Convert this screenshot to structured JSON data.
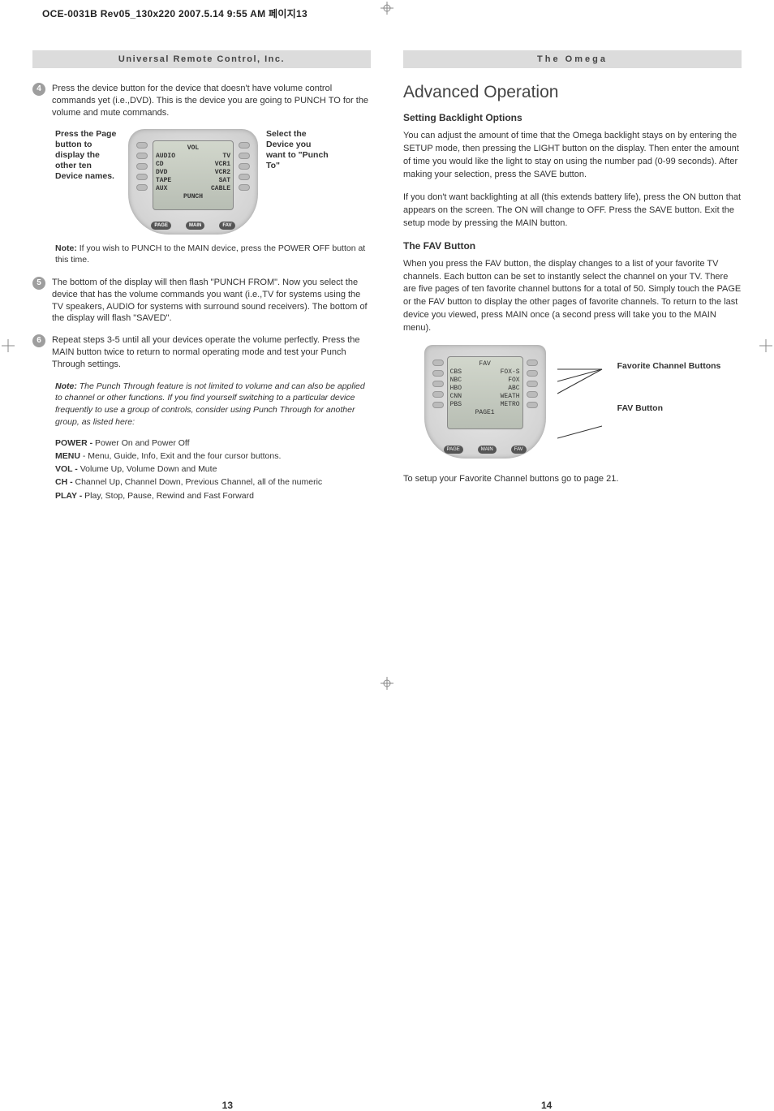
{
  "docHeader": "OCE-0031B Rev05_130x220  2007.5.14 9:55 AM  페이지13",
  "leftPage": {
    "header": "Universal Remote Control, Inc.",
    "step4": {
      "num": "4",
      "text": "Press the device button for the device that doesn't have volume control commands yet (i.e.,DVD). This is the device you are going to PUNCH TO for the volume and mute commands."
    },
    "diagLeftLabel": "Press the Page button to display the other ten Device names.",
    "diagRightLabel": "Select the Device you want to \"Punch To\"",
    "remote1Screen": {
      "r0": [
        "",
        "VOL",
        ""
      ],
      "r1": [
        "AUDIO",
        "",
        "TV"
      ],
      "r2": [
        "CD",
        "",
        "VCR1"
      ],
      "r3": [
        "DVD",
        "",
        "VCR2"
      ],
      "r4": [
        "TAPE",
        "",
        "SAT"
      ],
      "r5": [
        "AUX",
        "",
        "CABLE"
      ],
      "r6": [
        "",
        "PUNCH",
        ""
      ]
    },
    "bottomBtns": [
      "PAGE",
      "MAIN",
      "FAV"
    ],
    "note1_a": "Note:",
    "note1_b": " If you wish to PUNCH to the MAIN device, press the POWER OFF button at this time.",
    "step5": {
      "num": "5",
      "text": "The bottom of the display will then flash \"PUNCH FROM\". Now you select the device that has the volume commands you want (i.e.,TV for systems using the TV speakers, AUDIO for systems with surround sound receivers). The bottom of the display will flash \"SAVED\"."
    },
    "step6": {
      "num": "6",
      "text": "Repeat steps 3-5 until all your devices operate the volume perfectly. Press the MAIN button twice to  return to normal operating mode and test your Punch Through settings."
    },
    "italicNote_a": "Note:",
    "italicNote_b": " The Punch Through feature is not limited to volume and can also be applied to channel or other functions. If you find yourself switching to a particular device frequently to use a group of controls, consider using Punch Through for another group, as listed here:",
    "defs": [
      {
        "term": "POWER -",
        "desc": " Power On and Power Off"
      },
      {
        "term": "MENU",
        "desc": " - Menu, Guide, Info, Exit and the four cursor buttons."
      },
      {
        "term": "VOL -",
        "desc": " Volume Up, Volume Down and Mute"
      },
      {
        "term": "CH  -",
        "desc": " Channel Up, Channel Down, Previous Channel, all of the numeric"
      },
      {
        "term": "PLAY -",
        "desc": " Play, Stop, Pause, Rewind and Fast Forward"
      }
    ],
    "pageNum": "13"
  },
  "rightPage": {
    "header": "The Omega",
    "h1": "Advanced Operation",
    "sec1_h": "Setting Backlight Options",
    "sec1_p1": "You can adjust the amount of time that the Omega backlight stays on by entering the SETUP mode, then pressing the LIGHT button on the display. Then enter the amount of time you would like the light to stay on using the number pad (0-99 seconds). After making your selection, press the SAVE button.",
    "sec1_p2": "If you don't want backlighting at all (this extends battery life), press the ON button that appears on the screen. The ON will change to OFF. Press the SAVE button. Exit the setup mode by pressing the MAIN button.",
    "sec2_h": "The FAV Button",
    "sec2_p1": "When you press the FAV button, the display changes to a list of your favorite TV channels. Each button can be set to instantly select the channel on your TV. There are five pages of ten favorite channel buttons for a total of 50. Simply touch the PAGE or the FAV button to display the other pages of favorite channels. To return to the last device you viewed, press MAIN once (a second press will take you to the MAIN menu).",
    "remote2Screen": {
      "r0": [
        "",
        "FAV",
        ""
      ],
      "r1": [
        "CBS",
        "",
        "FOX-S"
      ],
      "r2": [
        "NBC",
        "",
        "FOX"
      ],
      "r3": [
        "HBO",
        "",
        "ABC"
      ],
      "r4": [
        "CNN",
        "",
        "WEATH"
      ],
      "r5": [
        "PBS",
        "",
        "METRO"
      ],
      "r6": [
        "",
        "PAGE1",
        ""
      ]
    },
    "diag2Label1": "Favorite Channel Buttons",
    "diag2Label2": "FAV Button",
    "sec2_p2": "To setup your Favorite Channel buttons go to page 21.",
    "pageNum": "14"
  }
}
